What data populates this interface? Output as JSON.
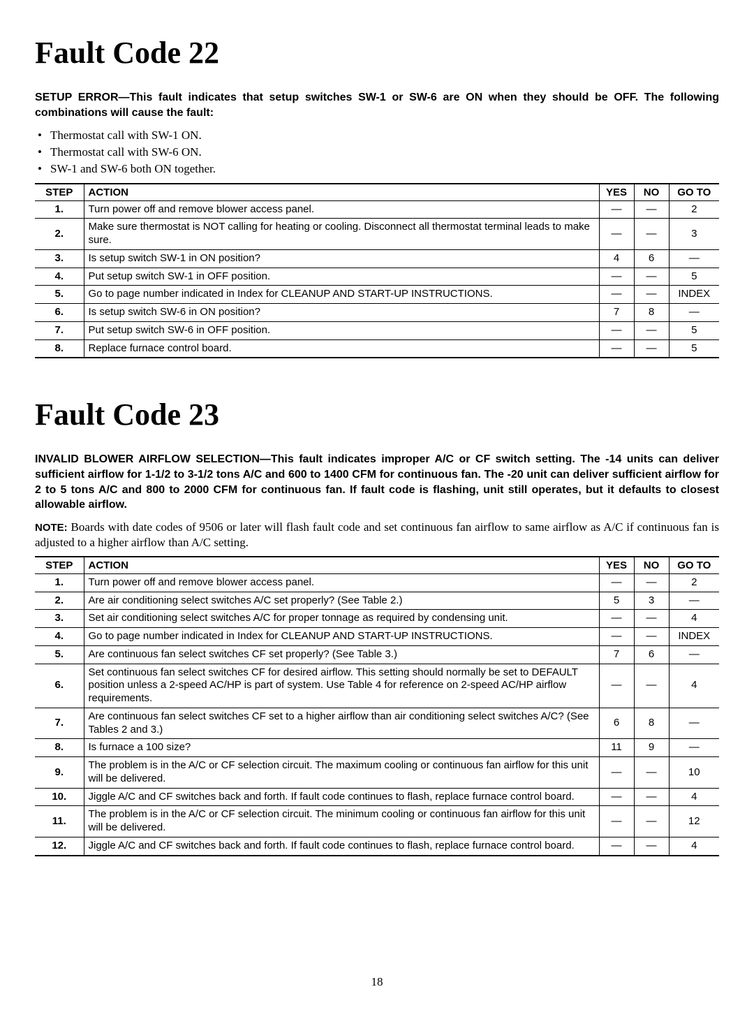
{
  "section1": {
    "title": "Fault Code 22",
    "intro": "SETUP ERROR—This fault indicates that setup switches SW-1 or SW-6 are ON when they should be OFF. The following combinations will cause the fault:",
    "causes": [
      "Thermostat call with SW-1 ON.",
      "Thermostat call with SW-6 ON.",
      "SW-1 and SW-6 both ON together."
    ],
    "headers": {
      "step": "STEP",
      "action": "ACTION",
      "yes": "YES",
      "no": "NO",
      "goto": "GO TO"
    },
    "rows": [
      {
        "step": "1.",
        "action": "Turn power off and remove blower access panel.",
        "yes": "—",
        "no": "—",
        "goto": "2"
      },
      {
        "step": "2.",
        "action": "Make sure thermostat is NOT calling for heating or cooling. Disconnect all thermostat terminal leads to make sure.",
        "yes": "—",
        "no": "—",
        "goto": "3"
      },
      {
        "step": "3.",
        "action": "Is setup switch SW-1 in ON position?",
        "yes": "4",
        "no": "6",
        "goto": "—"
      },
      {
        "step": "4.",
        "action": "Put setup switch SW-1 in OFF position.",
        "yes": "—",
        "no": "—",
        "goto": "5"
      },
      {
        "step": "5.",
        "action": "Go to page number indicated in Index for CLEANUP AND START-UP INSTRUCTIONS.",
        "yes": "—",
        "no": "—",
        "goto": "INDEX"
      },
      {
        "step": "6.",
        "action": "Is setup switch SW-6 in ON position?",
        "yes": "7",
        "no": "8",
        "goto": "—"
      },
      {
        "step": "7.",
        "action": "Put setup switch SW-6 in OFF position.",
        "yes": "—",
        "no": "—",
        "goto": "5"
      },
      {
        "step": "8.",
        "action": "Replace furnace control board.",
        "yes": "—",
        "no": "—",
        "goto": "5"
      }
    ]
  },
  "section2": {
    "title": "Fault Code 23",
    "intro": "INVALID BLOWER AIRFLOW SELECTION—This fault indicates improper A/C or CF switch setting. The -14 units can deliver sufficient airflow for 1-1/2 to 3-1/2 tons A/C and 600 to 1400 CFM for continuous fan. The -20 unit can deliver sufficient airflow for 2 to 5 tons A/C and 800 to 2000 CFM for continuous fan. If fault code is flashing, unit still operates, but it defaults to closest allowable airflow.",
    "note_label": "NOTE:",
    "note_body": " Boards with date codes of 9506 or later will flash fault code and set continuous fan airflow to same airflow as A/C if continuous fan is adjusted to a higher airflow than A/C setting.",
    "headers": {
      "step": "STEP",
      "action": "ACTION",
      "yes": "YES",
      "no": "NO",
      "goto": "GO TO"
    },
    "rows": [
      {
        "step": "1.",
        "action": "Turn power off and remove blower access panel.",
        "yes": "—",
        "no": "—",
        "goto": "2"
      },
      {
        "step": "2.",
        "action": "Are air conditioning select switches A/C set properly? (See Table 2.)",
        "yes": "5",
        "no": "3",
        "goto": "—"
      },
      {
        "step": "3.",
        "action": "Set air conditioning select switches A/C for proper tonnage as required by condensing unit.",
        "yes": "—",
        "no": "—",
        "goto": "4"
      },
      {
        "step": "4.",
        "action": "Go to page number indicated in Index for CLEANUP AND START-UP INSTRUCTIONS.",
        "yes": "—",
        "no": "—",
        "goto": "INDEX"
      },
      {
        "step": "5.",
        "action": "Are continuous fan select switches CF set properly? (See Table 3.)",
        "yes": "7",
        "no": "6",
        "goto": "—"
      },
      {
        "step": "6.",
        "action": "Set continuous fan select switches CF for desired airflow. This setting should normally be set to DEFAULT position unless a 2-speed AC/HP is part of system. Use Table 4 for reference on 2-speed AC/HP airflow requirements.",
        "yes": "—",
        "no": "—",
        "goto": "4"
      },
      {
        "step": "7.",
        "action": "Are continuous fan select switches CF set to a higher airflow than air conditioning select switches A/C? (See Tables 2 and 3.)",
        "yes": "6",
        "no": "8",
        "goto": "—"
      },
      {
        "step": "8.",
        "action": "Is furnace a 100 size?",
        "yes": "11",
        "no": "9",
        "goto": "—"
      },
      {
        "step": "9.",
        "action": "The problem is in the A/C or CF selection circuit. The maximum cooling or continuous fan airflow for this unit will be delivered.",
        "yes": "—",
        "no": "—",
        "goto": "10"
      },
      {
        "step": "10.",
        "action": "Jiggle A/C and CF switches back and forth. If fault code continues to flash, replace furnace control board.",
        "yes": "—",
        "no": "—",
        "goto": "4"
      },
      {
        "step": "11.",
        "action": "The problem is in the A/C or CF selection circuit. The minimum cooling or continuous fan airflow for this unit will be delivered.",
        "yes": "—",
        "no": "—",
        "goto": "12"
      },
      {
        "step": "12.",
        "action": "Jiggle A/C and CF switches back and forth. If fault code continues to flash, replace furnace control board.",
        "yes": "—",
        "no": "—",
        "goto": "4"
      }
    ]
  },
  "page_number": "18"
}
